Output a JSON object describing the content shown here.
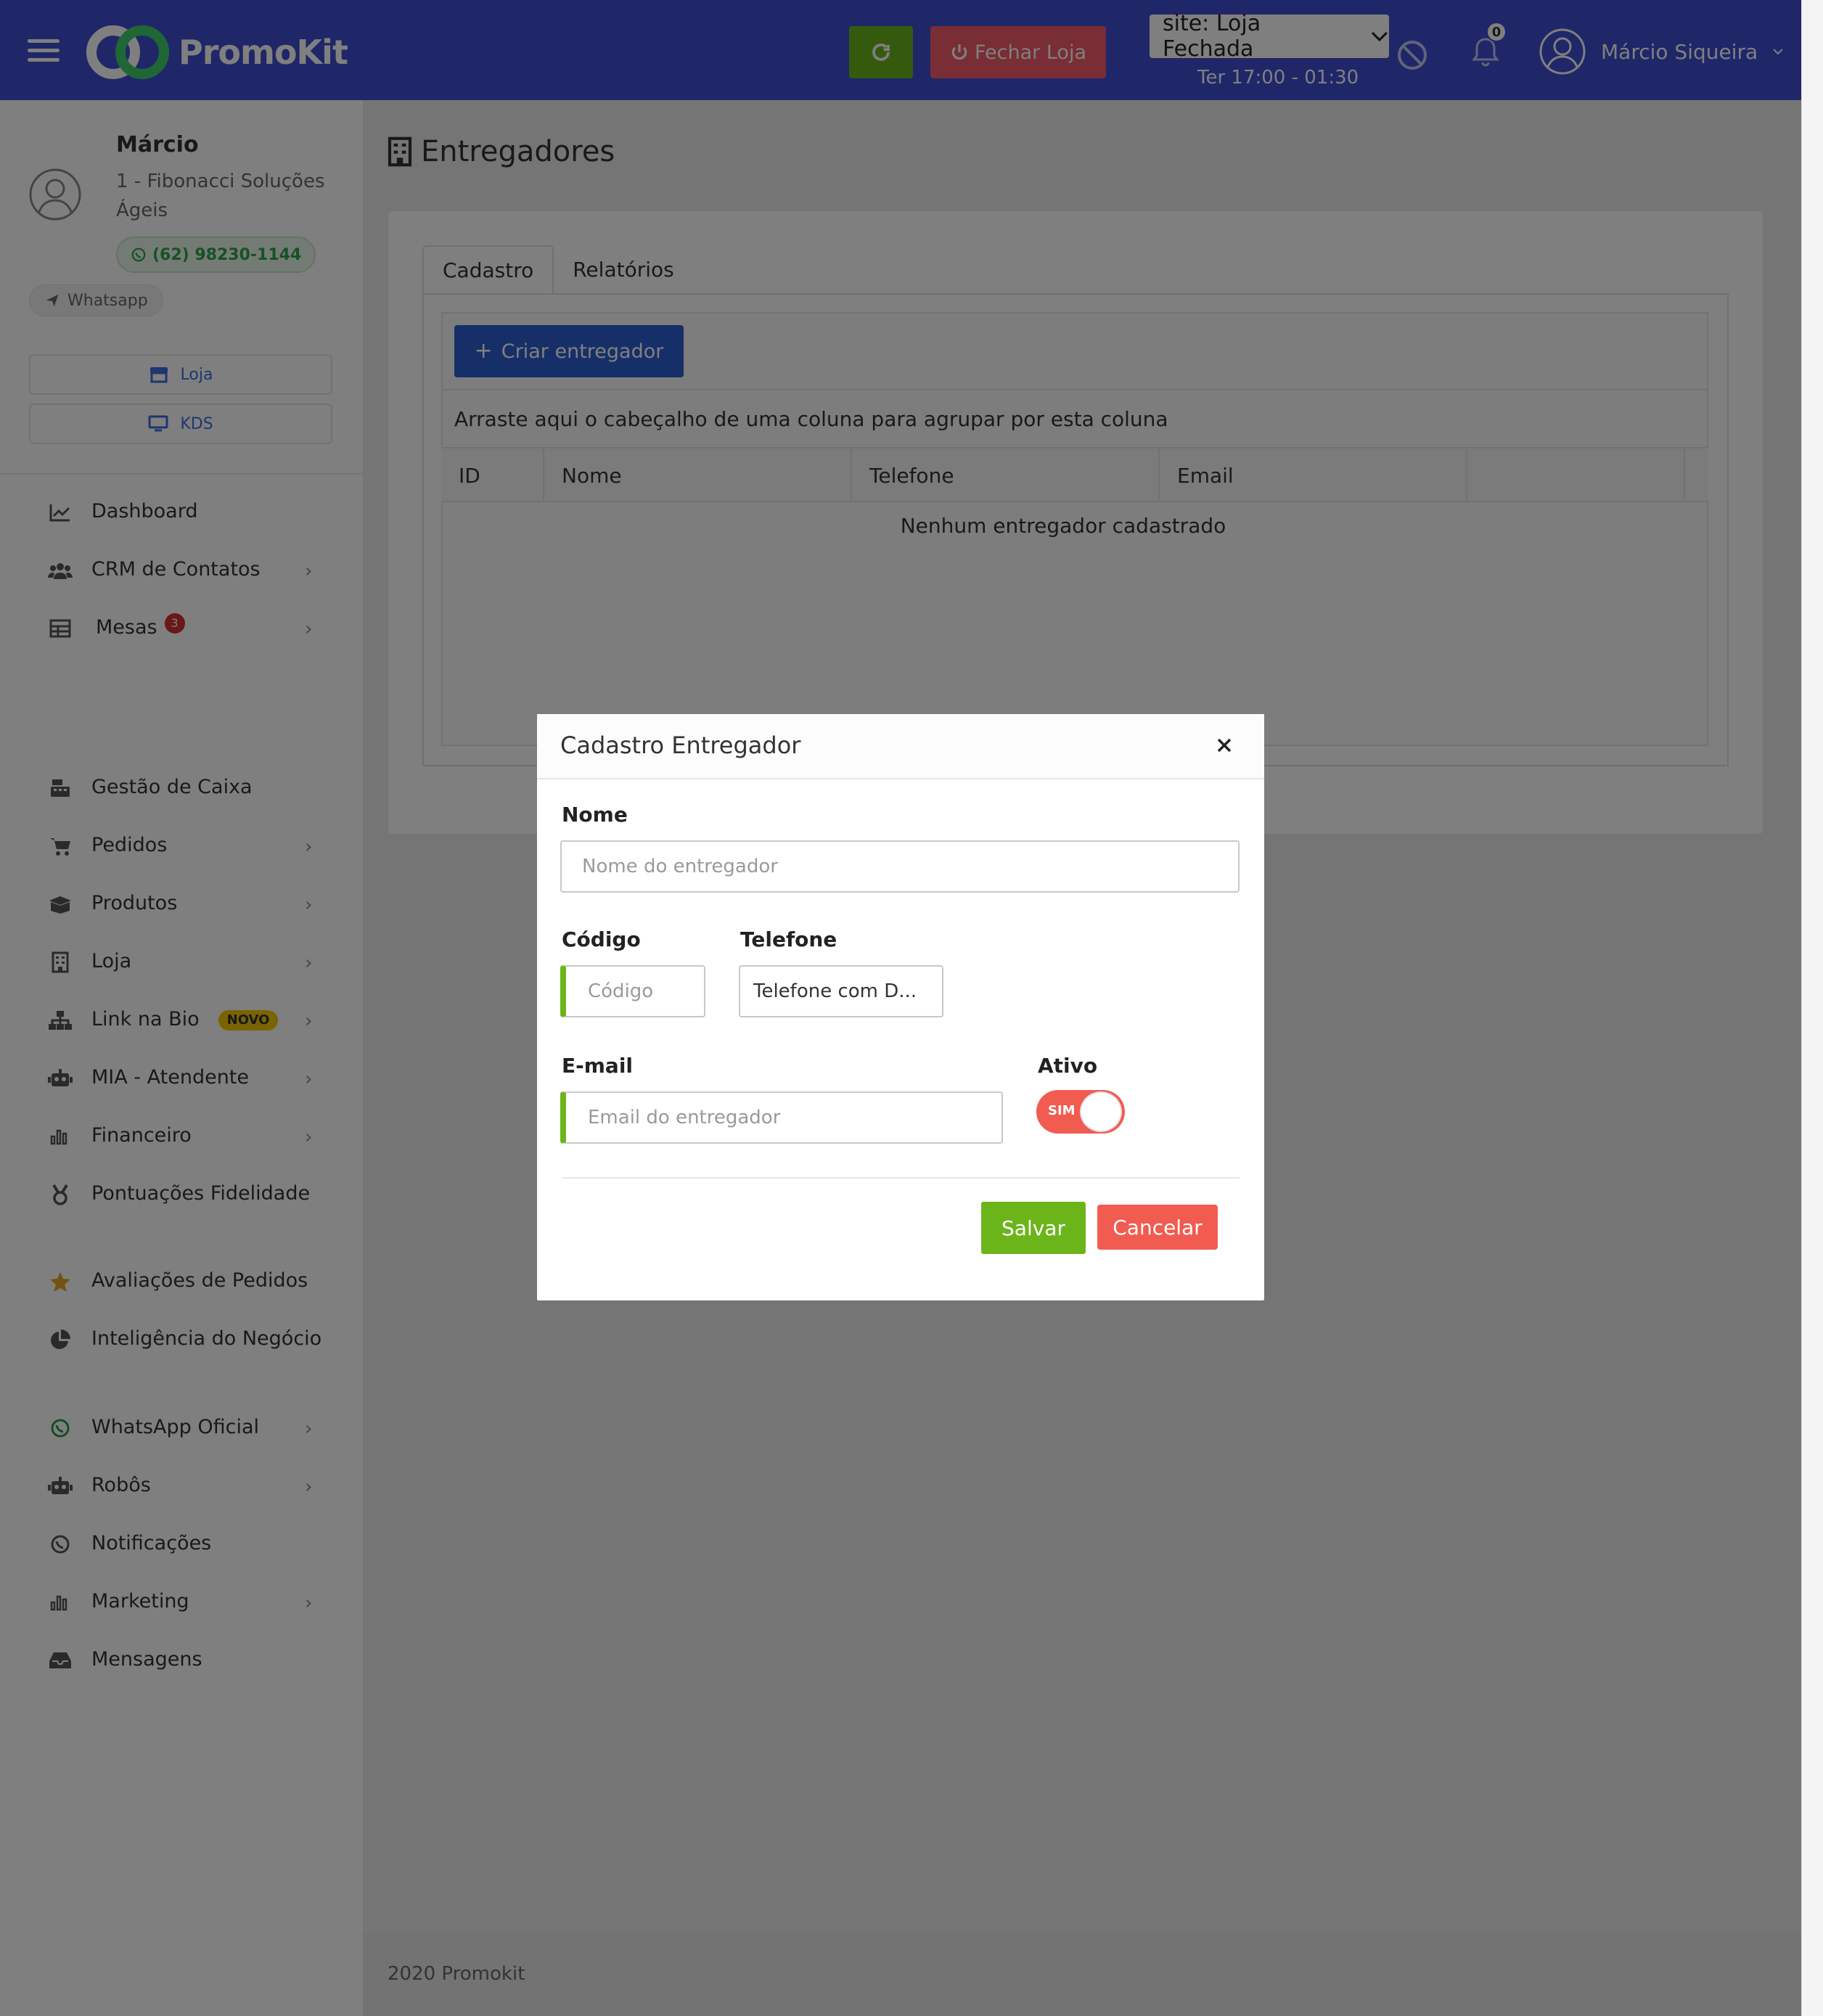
{
  "header": {
    "brand": "PromoKit",
    "close_store_label": "Fechar Loja",
    "site_select": "site: Loja Fechada",
    "hours": "Ter 17:00 - 01:30",
    "notifications_count": "0",
    "user_name": "Márcio Siqueira"
  },
  "profile": {
    "name": "Márcio",
    "company": "1 - Fibonacci Soluções Ágeis",
    "phone": "(62) 98230-1144",
    "whatsapp_label": "Whatsapp"
  },
  "quick_buttons": {
    "loja": "Loja",
    "kds": "KDS"
  },
  "menu": {
    "items": [
      {
        "label": "Dashboard",
        "icon": "chart-line-icon"
      },
      {
        "label": "CRM de Contatos",
        "icon": "users-icon"
      },
      {
        "label": "Mesas",
        "icon": "table-icon",
        "badge": "3"
      },
      {
        "label": "Gestão de Caixa",
        "icon": "cash-register-icon"
      },
      {
        "label": "Pedidos",
        "icon": "cart-icon"
      },
      {
        "label": "Produtos",
        "icon": "box-icon"
      },
      {
        "label": "Loja",
        "icon": "building-icon"
      },
      {
        "label": "Link na Bio",
        "icon": "sitemap-icon",
        "badge": "NOVO"
      },
      {
        "label": "MIA - Atendente",
        "icon": "robot-icon"
      },
      {
        "label": "Financeiro",
        "icon": "bar-chart-icon"
      },
      {
        "label": "Pontuações Fidelidade",
        "icon": "medal-icon"
      },
      {
        "label": "Avaliações de Pedidos",
        "icon": "star-icon"
      },
      {
        "label": "Inteligência do Negócio",
        "icon": "pie-chart-icon"
      },
      {
        "label": "WhatsApp Oficial",
        "icon": "whatsapp-icon"
      },
      {
        "label": "Robôs",
        "icon": "robot-icon"
      },
      {
        "label": "Notificações",
        "icon": "whatsapp-icon"
      },
      {
        "label": "Marketing",
        "icon": "bar-chart-icon"
      },
      {
        "label": "Mensagens",
        "icon": "inbox-icon"
      }
    ]
  },
  "page": {
    "title": "Entregadores",
    "tabs": [
      "Cadastro",
      "Relatórios"
    ],
    "create_button": "Criar entregador",
    "group_hint": "Arraste aqui o cabeçalho de uma coluna para agrupar por esta coluna",
    "columns": [
      "ID",
      "Nome",
      "Telefone",
      "Email",
      ""
    ],
    "empty_message": "Nenhum entregador cadastrado"
  },
  "footer": {
    "text": "2020 Promokit"
  },
  "modal": {
    "title": "Cadastro Entregador",
    "nome_label": "Nome",
    "nome_placeholder": "Nome do entregador",
    "codigo_label": "Código",
    "codigo_placeholder": "Código",
    "telefone_label": "Telefone",
    "telefone_placeholder": "Telefone com D...",
    "email_label": "E-mail",
    "email_placeholder": "Email do entregador",
    "ativo_label": "Ativo",
    "ativo_toggle": "SIM",
    "save_label": "Salvar",
    "cancel_label": "Cancelar"
  },
  "colors": {
    "header_bg": "#3f4fd3",
    "green": "#6bb51a",
    "red": "#f25b50",
    "primary_blue": "#2f5fd0"
  }
}
